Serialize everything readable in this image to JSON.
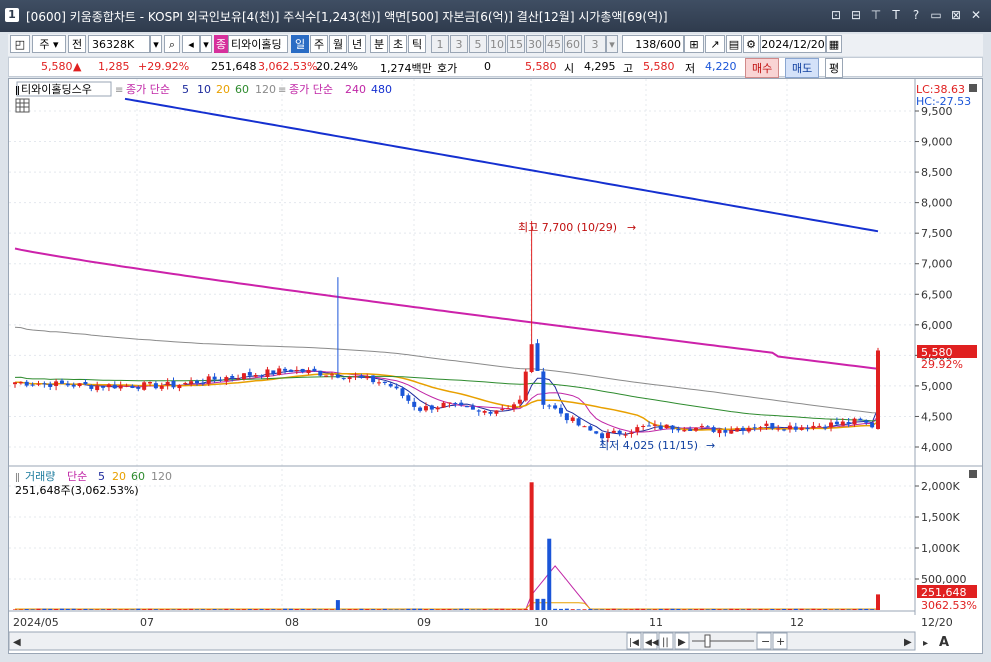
{
  "window": {
    "number": "1",
    "title": "[0600] 키움종합차트 - KOSPI 외국인보유[4(천)] 주식수[1,243(천)] 액면[500] 자본금[6(억)] 결산[12월] 시가총액[69(억)]",
    "controls": [
      "⊡",
      "⊟",
      "⊤",
      "T",
      "?",
      "▭",
      "⊠",
      "✕"
    ]
  },
  "toolbar": {
    "period_select": "주",
    "prev_label": "전",
    "code": "36328K",
    "stock_name": "티와이홀딩",
    "stock_badge": "종",
    "periods": [
      "일",
      "주",
      "월",
      "년",
      "분",
      "초",
      "틱"
    ],
    "active_period": "일",
    "intervals": [
      "1",
      "3",
      "5",
      "10",
      "15",
      "30",
      "45",
      "60"
    ],
    "interval_value": "3",
    "count": "138",
    "count_total": "/600",
    "date": "2024/12/20"
  },
  "infobar": {
    "price": "5,580",
    "change": "1,285",
    "change_pct": "+29.92%",
    "volume": "251,648",
    "volume_pct": "3,062.53%",
    "turnover": "20.24%",
    "amount": "1,274백만",
    "quote_label": "호가",
    "quote_value": "0",
    "quote_price": "5,580",
    "open_label": "시",
    "open": "4,295",
    "high_label": "고",
    "high": "5,580",
    "low_label": "저",
    "low": "4,220",
    "buy_label": "매수",
    "sell_label": "매도",
    "flat_label": "평"
  },
  "price_panel": {
    "stock_tag": "티와이홀딩스우",
    "legend1_name": "종가 단순",
    "legend1_periods": [
      "5",
      "10",
      "20",
      "60",
      "120"
    ],
    "legend2_name": "종가 단순",
    "legend2_periods": [
      "240",
      "480"
    ],
    "lc": "LC:38.63",
    "hc": "HC:-27.53",
    "high_annotation": "최고 7,700 (10/29)",
    "low_annotation": "최저 4,025 (11/15)",
    "current_price_box": "5,580",
    "current_pct_box": "29.92%",
    "yaxis_labels": [
      "9,500",
      "9,000",
      "8,500",
      "8,000",
      "7,500",
      "7,000",
      "6,500",
      "6,000",
      "5,500",
      "5,000",
      "4,500",
      "4,000"
    ],
    "colors": {
      "ma5": "#1d2a9c",
      "ma10": "#c026a6",
      "ma20": "#e8a000",
      "ma60": "#2e8b2e",
      "ma120": "#8a8a8a",
      "ma240": "#cc22aa",
      "ma480": "#1530d0",
      "up": "#e02020",
      "down": "#1a55d8"
    }
  },
  "volume_panel": {
    "title": "거래량",
    "legend_name": "단순",
    "periods": [
      "5",
      "20",
      "60",
      "120"
    ],
    "current_label": "251,648주(3,062.53%)",
    "yaxis_labels": [
      "2,000K",
      "1,500K",
      "1,000K",
      "500,000"
    ],
    "current_value_box": "251,648",
    "current_pct_box": "3062.53%"
  },
  "xaxis_labels": [
    "2024/05",
    "07",
    "08",
    "09",
    "10",
    "11",
    "12",
    "12/20"
  ],
  "chart_data": {
    "type": "candlestick",
    "ylim": [
      3900,
      9700
    ],
    "ma240_approx": {
      "start": 7250,
      "end": 5330
    },
    "ma480_approx": {
      "start": 9700,
      "end": 7530
    },
    "high": {
      "value": 7700,
      "date": "10/29"
    },
    "low": {
      "value": 4025,
      "date": "11/15"
    },
    "last_close": 5580
  }
}
